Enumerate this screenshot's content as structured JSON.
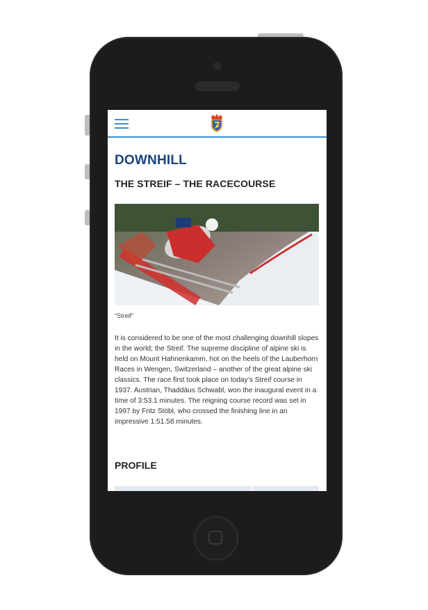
{
  "screen": {
    "header": {
      "menu_icon": "hamburger-icon",
      "logo_icon": "club-crest-logo",
      "accent_color": "#3a8fd0"
    },
    "article": {
      "title": "DOWNHILL",
      "title_color": "#1a4480",
      "subtitle": "THE STREIF – THE RACECOURSE",
      "image_caption": "“Streif”",
      "body": "It is considered to be one of the most challenging downhill slopes in the world; the Streif. The supreme discipline of alpine ski is held on Mount Hahnenkamm, hot on the heels of the Lauberhorn Races in Wengen, Switzerland – another of the great alpine ski classics. The race first took place on today’s Streif course in 1937. Austrian, Thaddäus Schwabl, won the inaugural event in a time of 3:53.1 minutes. The reigning course record was set in 1997 by Fritz Stöbl, who crossed the finishing line in an impressive 1:51.58 minutes.",
      "section_heading": "PROFILE"
    }
  }
}
